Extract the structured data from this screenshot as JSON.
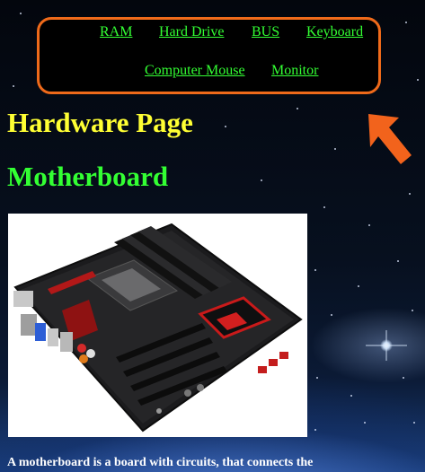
{
  "nav": {
    "items": [
      {
        "label": "RAM"
      },
      {
        "label": "Hard Drive"
      },
      {
        "label": "BUS"
      },
      {
        "label": "Keyboard"
      },
      {
        "label": "Computer Mouse"
      },
      {
        "label": "Monitor"
      }
    ],
    "link_color": "#33ff33",
    "border_color": "#ef6a1a"
  },
  "page_title": "Hardware Page",
  "section": {
    "title": "Motherboard",
    "image": "motherboard-photo",
    "description": "A motherboard is a board with circuits, that connects the"
  },
  "colors": {
    "title": "#ffff33",
    "section_title": "#33ff33",
    "arrow": "#f2631c"
  },
  "background": "space-earth-horizon"
}
